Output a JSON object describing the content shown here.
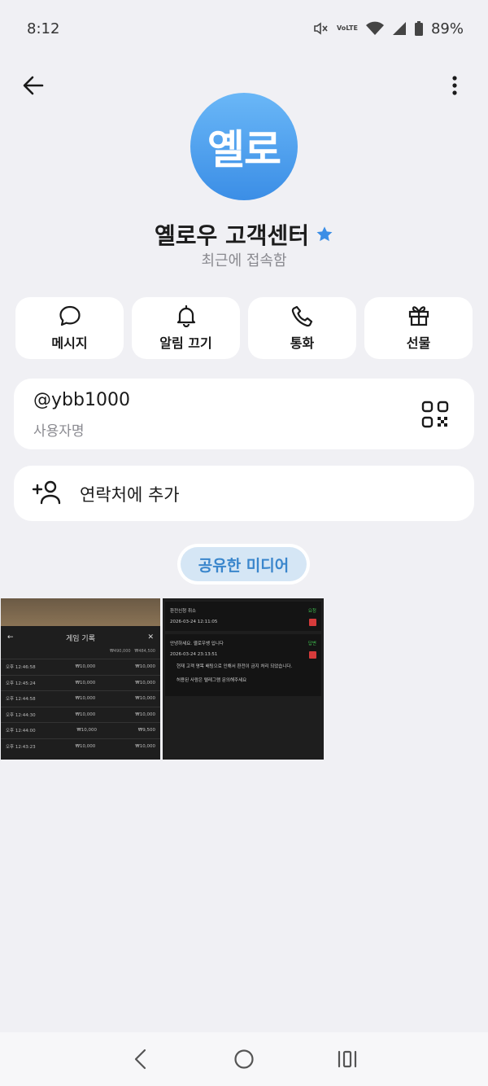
{
  "status_bar": {
    "time": "8:12",
    "volte_top": "Vo",
    "volte_bottom": "LTE",
    "battery": "89%"
  },
  "profile": {
    "avatar_text": "옐로",
    "name": "옐로우 고객센터",
    "status": "최근에 접속함",
    "accent_color": "#3b8ee6"
  },
  "actions": [
    {
      "label": "메시지",
      "icon": "chat-bubble-icon"
    },
    {
      "label": "알림 끄기",
      "icon": "bell-icon"
    },
    {
      "label": "통화",
      "icon": "phone-icon"
    },
    {
      "label": "선물",
      "icon": "gift-icon"
    }
  ],
  "username": {
    "value": "@ybb1000",
    "label": "사용자명"
  },
  "contact": {
    "label": "연락처에 추가"
  },
  "media": {
    "chip_label": "공유한 미디어",
    "thumb1": {
      "title": "게임 기록",
      "rows": [
        [
          "오후 12:46:58",
          "₩10,000",
          "₩10,000"
        ],
        [
          "오후 12:45:24",
          "₩10,000",
          "₩10,000"
        ],
        [
          "오후 12:44:58",
          "₩10,000",
          "₩10,000"
        ],
        [
          "오후 12:44:30",
          "₩10,000",
          "₩10,000"
        ],
        [
          "오후 12:44:00",
          "₩10,000",
          "₩9,500"
        ],
        [
          "오후 12:43:23",
          "₩10,000",
          "₩10,000"
        ]
      ]
    },
    "thumb2": {
      "line1_date": "2026-03-24 12:11:05",
      "line2_date": "2026-03-24 23:13:51"
    }
  },
  "nav": {
    "back": "back-nav-icon",
    "home": "home-nav-icon",
    "recents": "recents-nav-icon"
  }
}
